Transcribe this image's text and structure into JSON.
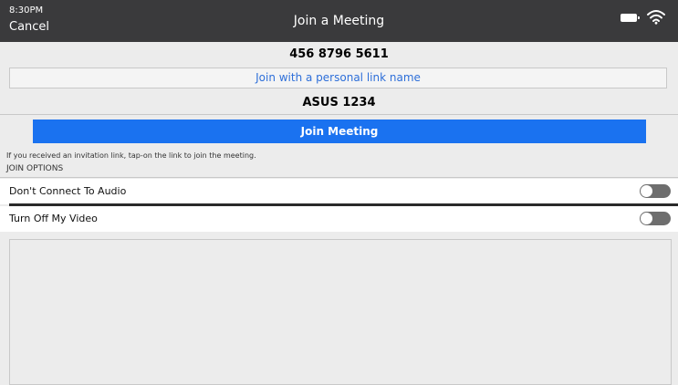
{
  "status_bar": {
    "time": "8:30PM"
  },
  "header": {
    "cancel_label": "Cancel",
    "title": "Join a Meeting"
  },
  "meeting": {
    "id": "456 8796 5611",
    "personal_link_label": "Join with a personal link name",
    "screen_name": "ASUS 1234",
    "join_button_label": "Join Meeting",
    "hint": "If you received an invitation link, tap-on the link to join the meeting."
  },
  "join_options": {
    "heading": "JOIN OPTIONS",
    "items": [
      {
        "label": "Don't Connect To Audio",
        "enabled": false
      },
      {
        "label": "Turn Off My Video",
        "enabled": false
      }
    ]
  },
  "colors": {
    "header_bg": "#3a3a3c",
    "accent": "#1a72f0",
    "link": "#2e6fd9",
    "toggle_off": "#6e6e6e"
  }
}
